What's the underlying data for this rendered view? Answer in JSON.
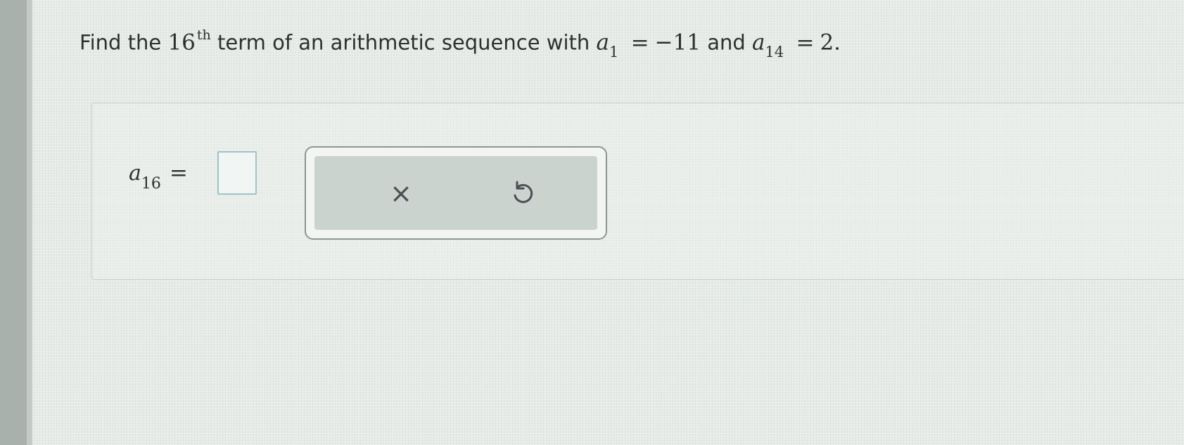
{
  "question": {
    "prefix": "Find the",
    "ordinal_number": "16",
    "ordinal_suffix": "th",
    "middle": "term of an arithmetic sequence with",
    "term1_var": "a",
    "term1_index": "1",
    "term1_relation": "=",
    "term1_value": "−11",
    "connector": "and",
    "term2_var": "a",
    "term2_index": "14",
    "term2_relation": "=",
    "term2_value": "2."
  },
  "answer": {
    "var": "a",
    "index": "16",
    "relation": "=",
    "value": ""
  },
  "toolbar": {
    "clear_icon": "clear-icon",
    "clear_glyph": "×",
    "undo_icon": "undo-icon"
  },
  "colors": {
    "input_border": "#9fc3c9",
    "tool_background": "#cbd3cf",
    "text": "#2f2f2f"
  }
}
